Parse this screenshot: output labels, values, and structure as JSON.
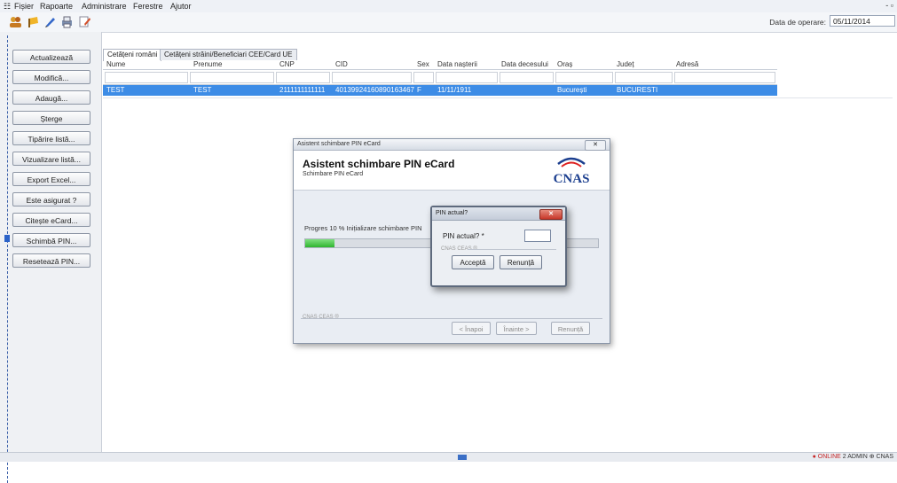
{
  "menu": {
    "icon_glyph": "☷",
    "items": [
      "Fișier",
      "Rapoarte",
      "Administrare",
      "Ferestre",
      "Ajutor"
    ],
    "window_controls": "- ▫"
  },
  "toolbar": {
    "icons": [
      "people-icon",
      "flag-icon",
      "pencil-icon",
      "print-icon",
      "edit-icon"
    ],
    "op_date_label": "Data de operare:",
    "op_date": "05/11/2014"
  },
  "sidebar": {
    "buttons": [
      "Actualizează",
      "Modifică...",
      "Adaugă...",
      "Șterge",
      "Tipărire listă...",
      "Vizualizare listă...",
      "Export Excel...",
      "Este asigurat ?",
      "Citește eCard...",
      "Schimbă PIN...",
      "Resetează PIN..."
    ]
  },
  "tabs": [
    "Cetățeni români",
    "Cetățeni străini/Beneficiari CEE/Card UE"
  ],
  "grid": {
    "columns": [
      "Nume",
      "Prenume",
      "CNP",
      "CID",
      "Sex",
      "Data nașterii",
      "Data decesului",
      "Oraș",
      "Județ",
      "Adresă"
    ],
    "row": [
      "TEST",
      "TEST",
      "2111111111111",
      "40139924160890163467",
      "F",
      "11/11/1911",
      "",
      "București",
      "BUCURESTI",
      ""
    ]
  },
  "wizard": {
    "title": "Asistent schimbare PIN eCard",
    "heading": "Asistent schimbare PIN eCard",
    "subheading": "Schimbare PIN eCard",
    "logo_text": "CNAS",
    "progress_label": "Progres 10 % Inițializare schimbare PIN",
    "progress_percent": 10,
    "separator_label": "CNAS CEAS ®",
    "buttons": [
      "< Înapoi",
      "Înainte >",
      "Renunță"
    ]
  },
  "pin_dialog": {
    "title": "PIN actual?",
    "label": "PIN actual? *",
    "value": "",
    "separator_label": "CNAS CEAS ®",
    "accept": "Acceptă",
    "cancel": "Renunță",
    "close_glyph": "✕"
  },
  "status": {
    "left": "● ONLINE",
    "right": "2 ADMIN ⊕ CNAS"
  },
  "colors": {
    "selection": "#3d8ce6",
    "progress": "#2fb52f",
    "close_red": "#c7372a"
  }
}
